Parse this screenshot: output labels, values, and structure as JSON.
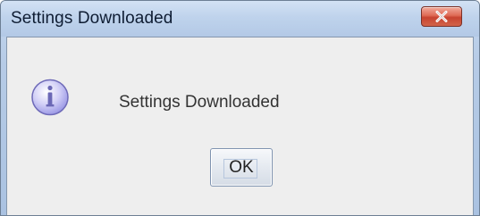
{
  "window": {
    "title": "Settings Downloaded"
  },
  "dialog": {
    "icon": "info-icon",
    "message": "Settings Downloaded",
    "ok_label": "OK"
  },
  "colors": {
    "titlebar": "#bfd3ec",
    "close_button": "#d2644a",
    "client_background": "#eeeeee",
    "info_icon": "#b8b5ef"
  }
}
